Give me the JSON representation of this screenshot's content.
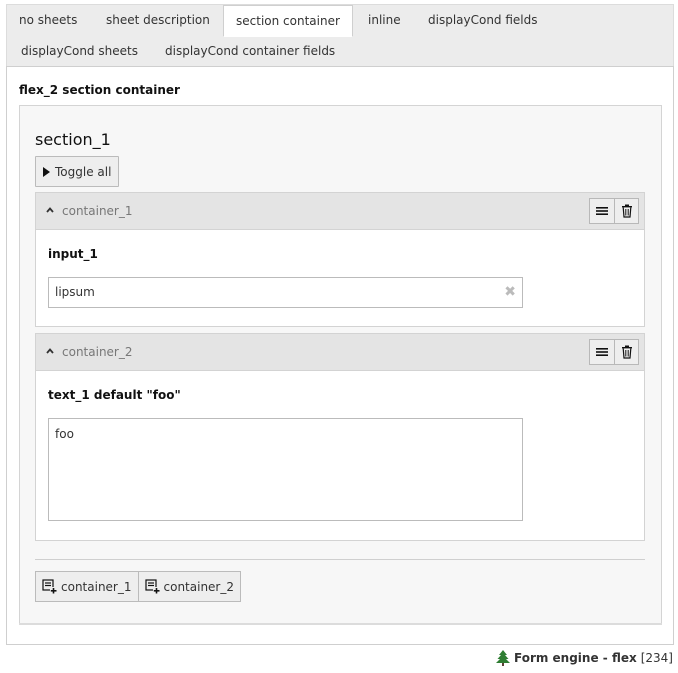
{
  "tabs": [
    {
      "label": "no sheets"
    },
    {
      "label": "sheet description"
    },
    {
      "label": "section container",
      "active": true
    },
    {
      "label": "inline"
    },
    {
      "label": "displayCond fields"
    },
    {
      "label": "displayCond sheets"
    },
    {
      "label": "displayCond container fields"
    }
  ],
  "panel": {
    "flex_title": "flex_2 section container",
    "section_title": "section_1",
    "toggle_label": "Toggle all",
    "containers": [
      {
        "label": "container_1",
        "field_label": "input_1",
        "field_value": "lipsum"
      },
      {
        "label": "container_2",
        "field_label": "text_1 default \"foo\"",
        "field_value": "foo"
      }
    ],
    "add_buttons": [
      {
        "label": "container_1"
      },
      {
        "label": "container_2"
      }
    ]
  },
  "footer": {
    "title": "Form engine - flex",
    "count": "[234]"
  },
  "icons": {
    "tree": "tree-icon",
    "menu": "hamburger-icon",
    "delete": "trash-icon",
    "add": "add-content-icon"
  },
  "colors": {
    "tree_green": "#2e7d32"
  }
}
